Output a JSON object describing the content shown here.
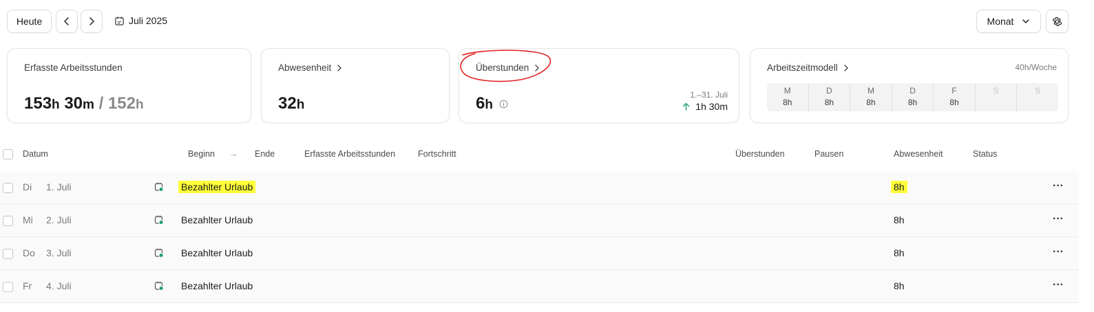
{
  "toolbar": {
    "today_label": "Heute",
    "period_label": "Juli 2025",
    "view_label": "Monat"
  },
  "cards": {
    "worked": {
      "title": "Erfasste Arbeitsstunden",
      "hours": "153",
      "h_unit": "h",
      "minutes": "30",
      "m_unit": "m",
      "separator": "/",
      "target": "152",
      "target_unit": "h"
    },
    "absence": {
      "title": "Abwesenheit",
      "value": "32",
      "unit": "h"
    },
    "overtime": {
      "title": "Überstunden",
      "value": "6",
      "unit": "h",
      "range": "1.–31. Juli",
      "delta": "1h 30m"
    },
    "model": {
      "title": "Arbeitszeitmodell",
      "weekly": "40h/Woche",
      "days": [
        {
          "day": "M",
          "hours": "8h"
        },
        {
          "day": "D",
          "hours": "8h"
        },
        {
          "day": "M",
          "hours": "8h"
        },
        {
          "day": "D",
          "hours": "8h"
        },
        {
          "day": "F",
          "hours": "8h"
        },
        {
          "day": "S",
          "hours": ""
        },
        {
          "day": "S",
          "hours": ""
        }
      ]
    }
  },
  "table": {
    "columns": {
      "date": "Datum",
      "start": "Beginn",
      "arrow": "→",
      "end": "Ende",
      "worked": "Erfasste Arbeitsstunden",
      "progress": "Fortschritt",
      "overtime": "Überstunden",
      "breaks": "Pausen",
      "absence": "Abwesenheit",
      "status": "Status"
    },
    "rows": [
      {
        "weekday": "Di",
        "date": "1. Juli",
        "type": "Bezahlter Urlaub",
        "absence": "8h"
      },
      {
        "weekday": "Mi",
        "date": "2. Juli",
        "type": "Bezahlter Urlaub",
        "absence": "8h"
      },
      {
        "weekday": "Do",
        "date": "3. Juli",
        "type": "Bezahlter Urlaub",
        "absence": "8h"
      },
      {
        "weekday": "Fr",
        "date": "4. Juli",
        "type": "Bezahlter Urlaub",
        "absence": "8h"
      }
    ],
    "row_menu": "···"
  },
  "colors": {
    "highlight": "#ffff3a",
    "annotation": "#e02020",
    "status_dot": "#1f9d6b",
    "up_arrow": "#1f9d6b"
  }
}
